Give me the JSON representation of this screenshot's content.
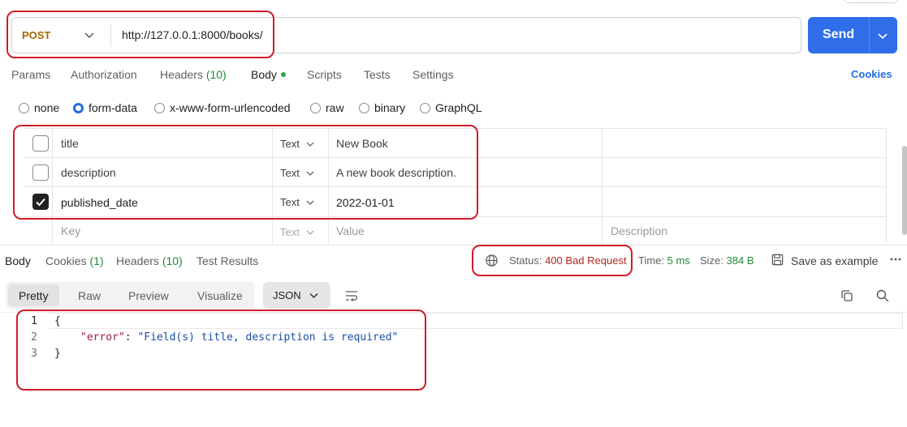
{
  "request": {
    "method": "POST",
    "url": "http://127.0.0.1:8000/books/",
    "send_label": "Send"
  },
  "request_tabs": [
    {
      "label": "Params"
    },
    {
      "label": "Authorization"
    },
    {
      "label": "Headers",
      "count": "(10)"
    },
    {
      "label": "Body",
      "active": true
    },
    {
      "label": "Scripts"
    },
    {
      "label": "Tests"
    },
    {
      "label": "Settings"
    }
  ],
  "cookies_link": "Cookies",
  "body_types": [
    {
      "label": "none",
      "selected": false
    },
    {
      "label": "form-data",
      "selected": true
    },
    {
      "label": "x-www-form-urlencoded",
      "selected": false
    },
    {
      "label": "raw",
      "selected": false
    },
    {
      "label": "binary",
      "selected": false
    },
    {
      "label": "GraphQL",
      "selected": false
    }
  ],
  "form_rows": [
    {
      "checked": false,
      "key": "title",
      "type": "Text",
      "value": "New Book"
    },
    {
      "checked": false,
      "key": "description",
      "type": "Text",
      "value": "A new book description."
    },
    {
      "checked": true,
      "key": "published_date",
      "type": "Text",
      "value": "2022-01-01"
    }
  ],
  "form_placeholder": {
    "key": "Key",
    "type": "Text",
    "value": "Value",
    "description": "Description"
  },
  "response_tabs": [
    {
      "label": "Body",
      "active": true
    },
    {
      "label": "Cookies",
      "count": "(1)"
    },
    {
      "label": "Headers",
      "count": "(10)"
    },
    {
      "label": "Test Results"
    }
  ],
  "response_meta": {
    "status_label": "Status:",
    "status_value": "400 Bad Request",
    "time_label": "Time:",
    "time_value": "5 ms",
    "size_label": "Size:",
    "size_value": "384 B",
    "save_label": "Save as example"
  },
  "view_tabs": [
    "Pretty",
    "Raw",
    "Preview",
    "Visualize"
  ],
  "language": "JSON",
  "code": {
    "line_numbers": [
      "1",
      "2",
      "3"
    ],
    "open_brace": "{",
    "key": "\"error\"",
    "colon": ": ",
    "value": "\"Field(s) title, description is required\"",
    "close_brace": "}"
  },
  "colors": {
    "send_button": "#2f6ee8",
    "method": "#a76a00",
    "status_error": "#b3261e",
    "accent_blue": "#1f6fe5",
    "highlight_box": "#d01c2a"
  }
}
